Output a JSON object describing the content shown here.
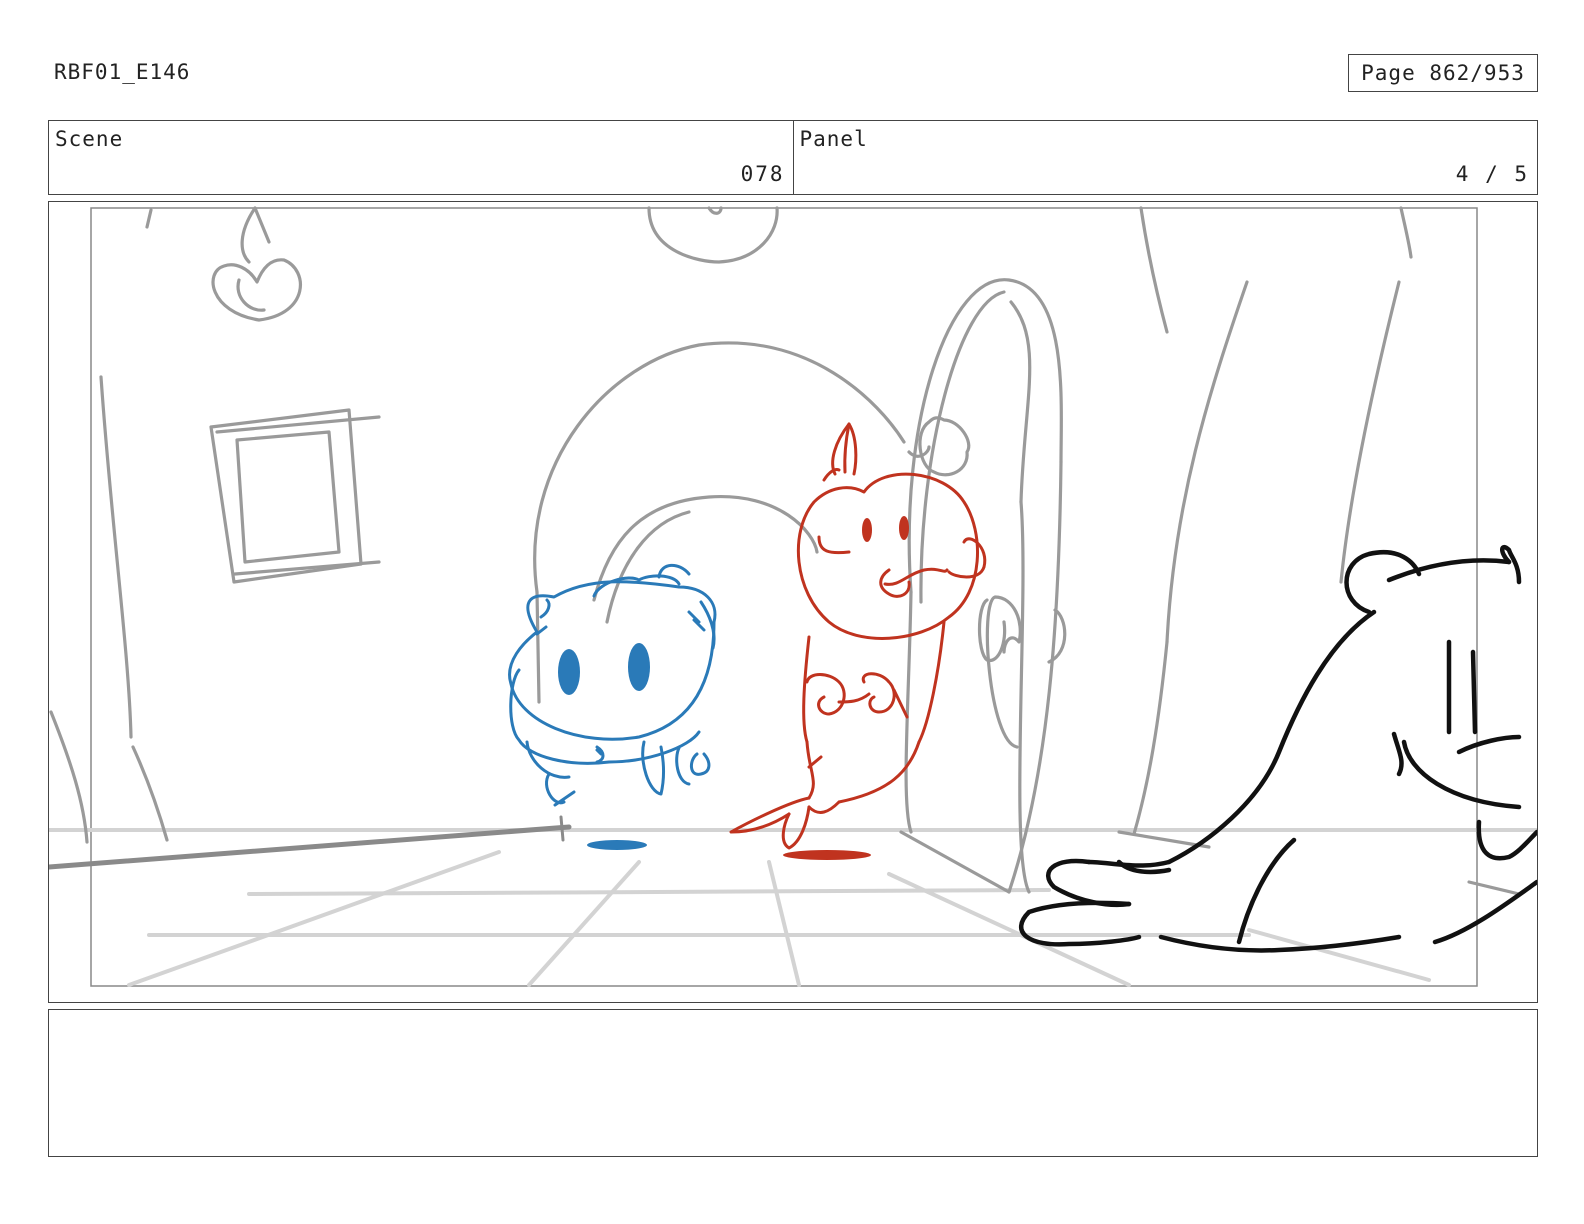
{
  "header": {
    "doc_id": "RBF01_E146",
    "page_label": "Page 862/953"
  },
  "info": {
    "scene_label": "Scene",
    "scene_value": "078",
    "panel_label": "Panel",
    "panel_value": "4 / 5"
  },
  "colors": {
    "blue_character": "#2a7ab8",
    "red_character": "#c0331f",
    "black_character": "#111111",
    "background_sketch": "#9a9a9a",
    "floor_sketch": "#d0d0d0"
  },
  "notes": {
    "text": ""
  }
}
